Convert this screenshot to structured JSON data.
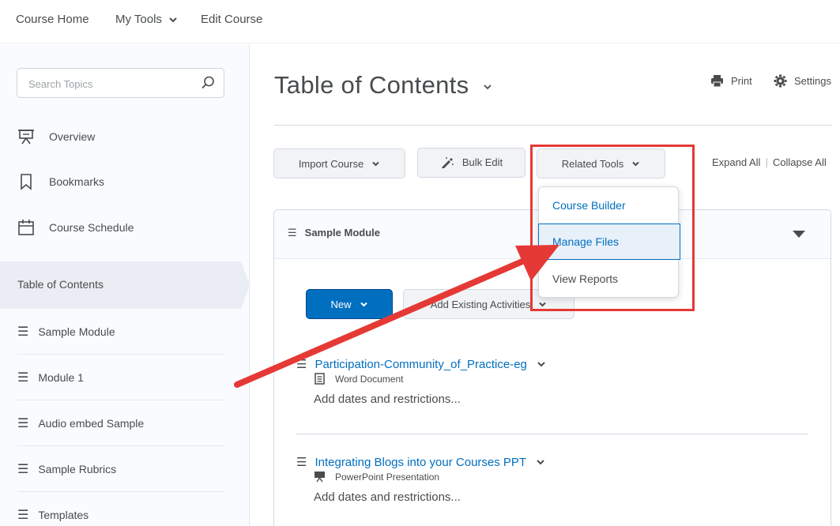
{
  "topnav": {
    "course_home": "Course Home",
    "my_tools": "My Tools",
    "edit_course": "Edit Course"
  },
  "sidebar": {
    "search_placeholder": "Search Topics",
    "items": [
      {
        "label": "Overview",
        "icon": "presentation-icon"
      },
      {
        "label": "Bookmarks",
        "icon": "bookmark-icon"
      },
      {
        "label": "Course Schedule",
        "icon": "calendar-icon"
      }
    ],
    "toc_label": "Table of Contents",
    "modules": [
      "Sample Module",
      "Module 1",
      "Audio embed Sample",
      "Sample Rubrics",
      "Templates"
    ]
  },
  "header": {
    "title": "Table of Contents",
    "print": "Print",
    "settings": "Settings"
  },
  "toolbar": {
    "import_course": "Import Course",
    "bulk_edit": "Bulk Edit",
    "related_tools": "Related Tools",
    "expand_all": "Expand All",
    "collapse_all": "Collapse All"
  },
  "related_tools_menu": {
    "items": [
      "Course Builder",
      "Manage Files",
      "View Reports"
    ],
    "active_index": 1
  },
  "module": {
    "title": "Sample Module",
    "new_button": "New",
    "add_existing": "Add Existing Activities",
    "topics": [
      {
        "title": "Participation-Community_of_Practice-eg",
        "type": "Word Document",
        "dates": "Add dates and restrictions..."
      },
      {
        "title": "Integrating Blogs into your Courses PPT",
        "type": "PowerPoint Presentation",
        "dates": "Add dates and restrictions..."
      }
    ]
  },
  "colors": {
    "accent": "#006fbf",
    "highlight_box": "#e53935",
    "arrow": "#e53935"
  }
}
